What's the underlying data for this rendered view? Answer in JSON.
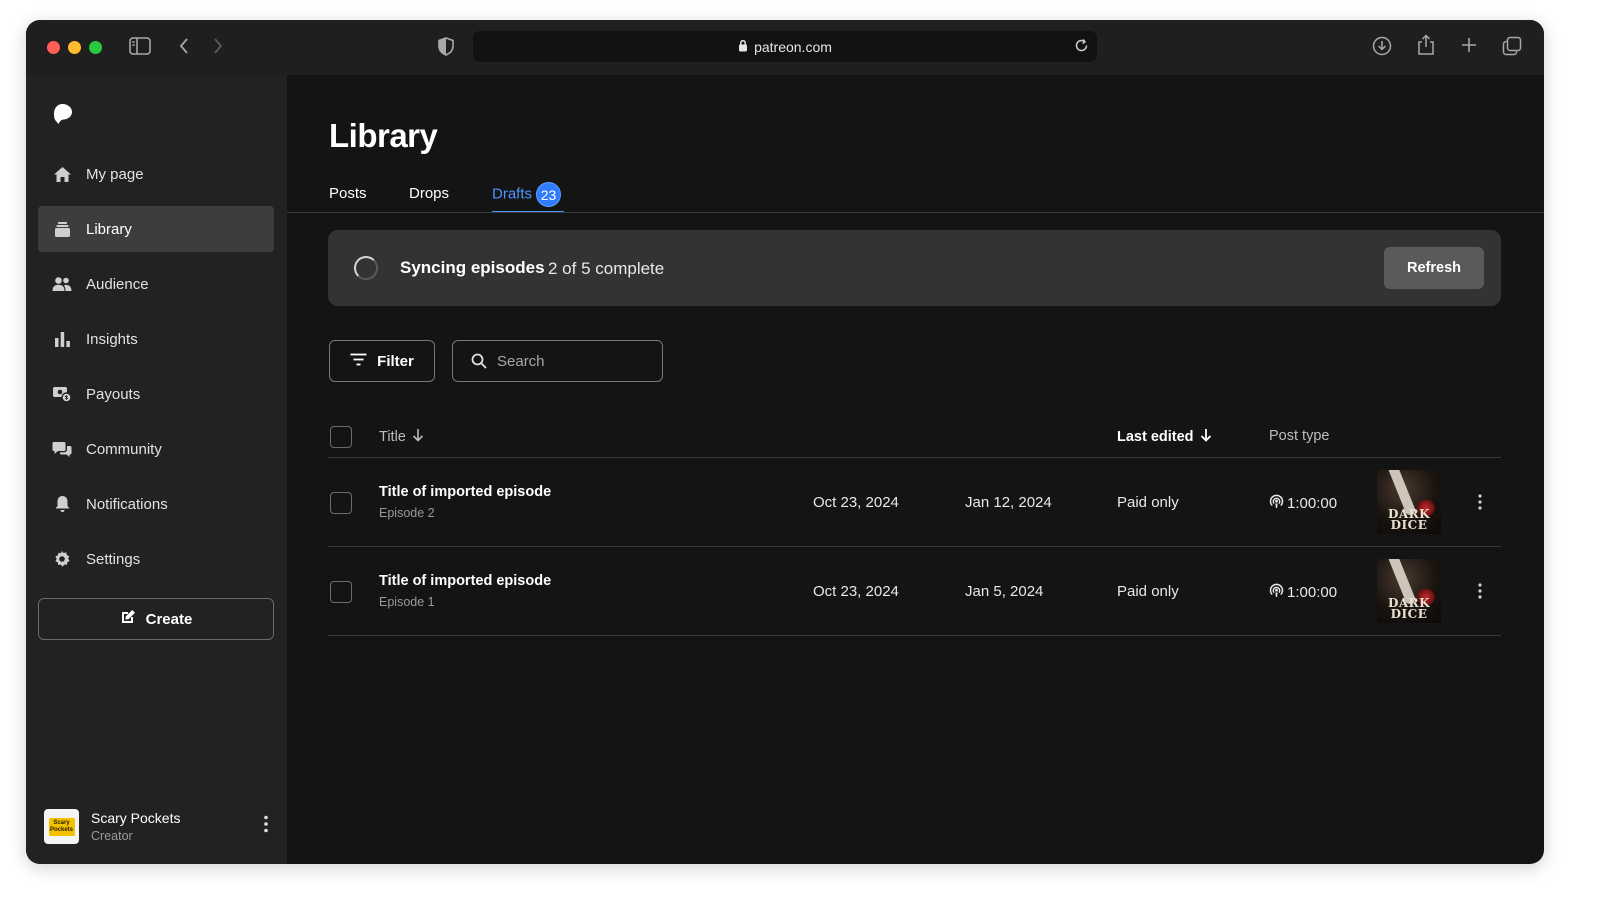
{
  "browser": {
    "url": "patreon.com"
  },
  "sidebar": {
    "items": [
      {
        "label": "My page",
        "icon": "home-icon"
      },
      {
        "label": "Library",
        "icon": "library-icon",
        "active": true
      },
      {
        "label": "Audience",
        "icon": "audience-icon"
      },
      {
        "label": "Insights",
        "icon": "insights-icon"
      },
      {
        "label": "Payouts",
        "icon": "payouts-icon"
      },
      {
        "label": "Community",
        "icon": "community-icon"
      },
      {
        "label": "Notifications",
        "icon": "bell-icon"
      },
      {
        "label": "Settings",
        "icon": "gear-icon"
      }
    ],
    "create_label": "Create",
    "profile": {
      "name": "Scary Pockets",
      "role": "Creator",
      "avatar_text": "Scary Pockets"
    }
  },
  "main": {
    "title": "Library",
    "tabs": [
      {
        "label": "Posts"
      },
      {
        "label": "Drops"
      },
      {
        "label": "Drafts",
        "badge": "23",
        "active": true
      }
    ],
    "sync": {
      "title": "Syncing episodes",
      "status": "2 of 5 complete",
      "refresh_label": "Refresh"
    },
    "filter_label": "Filter",
    "search": {
      "placeholder": "Search",
      "value": ""
    },
    "table": {
      "headers": {
        "title": "Title",
        "last_edited": "Last edited",
        "post_type": "Post type"
      },
      "rows": [
        {
          "title": "Title of imported episode",
          "subtitle": "Episode 2",
          "date1": "Oct 23, 2024",
          "date2": "Jan 12, 2024",
          "access": "Paid only",
          "duration": "1:00:00",
          "thumb_line1": "DARK",
          "thumb_line2": "DICE"
        },
        {
          "title": "Title of imported episode",
          "subtitle": "Episode 1",
          "date1": "Oct 23, 2024",
          "date2": "Jan 5, 2024",
          "access": "Paid only",
          "duration": "1:00:00",
          "thumb_line1": "DARK",
          "thumb_line2": "DICE"
        }
      ]
    }
  },
  "colors": {
    "accent": "#4e95ff",
    "badge": "#2f7cff",
    "sidebar_bg": "#222222",
    "main_bg": "#141414"
  }
}
